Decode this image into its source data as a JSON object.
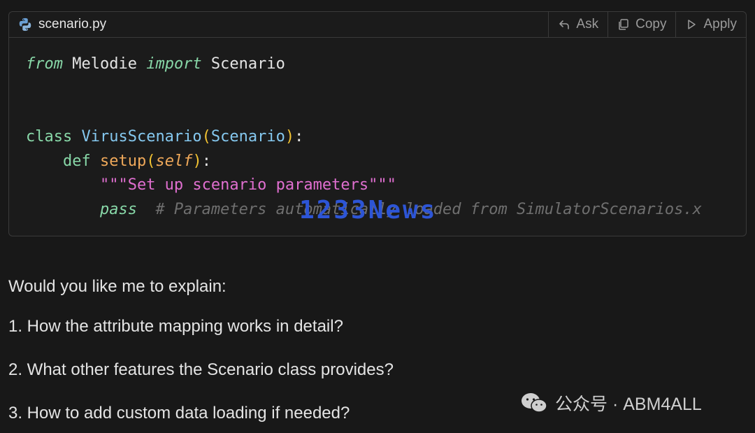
{
  "code_block": {
    "filename": "scenario.py",
    "actions": {
      "ask": "Ask",
      "copy": "Copy",
      "apply": "Apply"
    },
    "lines": {
      "l1": {
        "kw1": "from",
        "mod": " Melodie ",
        "kw2": "import",
        "name": " Scenario"
      },
      "l4": {
        "kw": "class",
        "cls": " VirusScenario",
        "p1": "(",
        "base": "Scenario",
        "p2": ")",
        "colon": ":"
      },
      "l5": {
        "indent": "    ",
        "kw": "def",
        "fn": " setup",
        "p1": "(",
        "self": "self",
        "p2": ")",
        "colon": ":"
      },
      "l6": {
        "indent": "        ",
        "doc": "\"\"\"Set up scenario parameters\"\"\""
      },
      "l7": {
        "indent": "        ",
        "kw": "pass",
        "comment": "  # Parameters automatically loaded from SimulatorScenarios.x"
      }
    }
  },
  "watermark": "1233News",
  "message": {
    "intro": "Would you like me to explain:",
    "items": [
      "1. How the attribute mapping works in detail?",
      "2. What other features the Scenario class provides?",
      "3. How to add custom data loading if needed?"
    ]
  },
  "brand": {
    "text": "公众号 · ABM4ALL"
  },
  "colors": {
    "background": "#181818",
    "keyword": "#88d8a8",
    "class_name": "#85c8ef",
    "paren": "#f1c232",
    "function": "#f0a95a",
    "string": "#e06fd0",
    "comment": "#6f6f6f"
  }
}
